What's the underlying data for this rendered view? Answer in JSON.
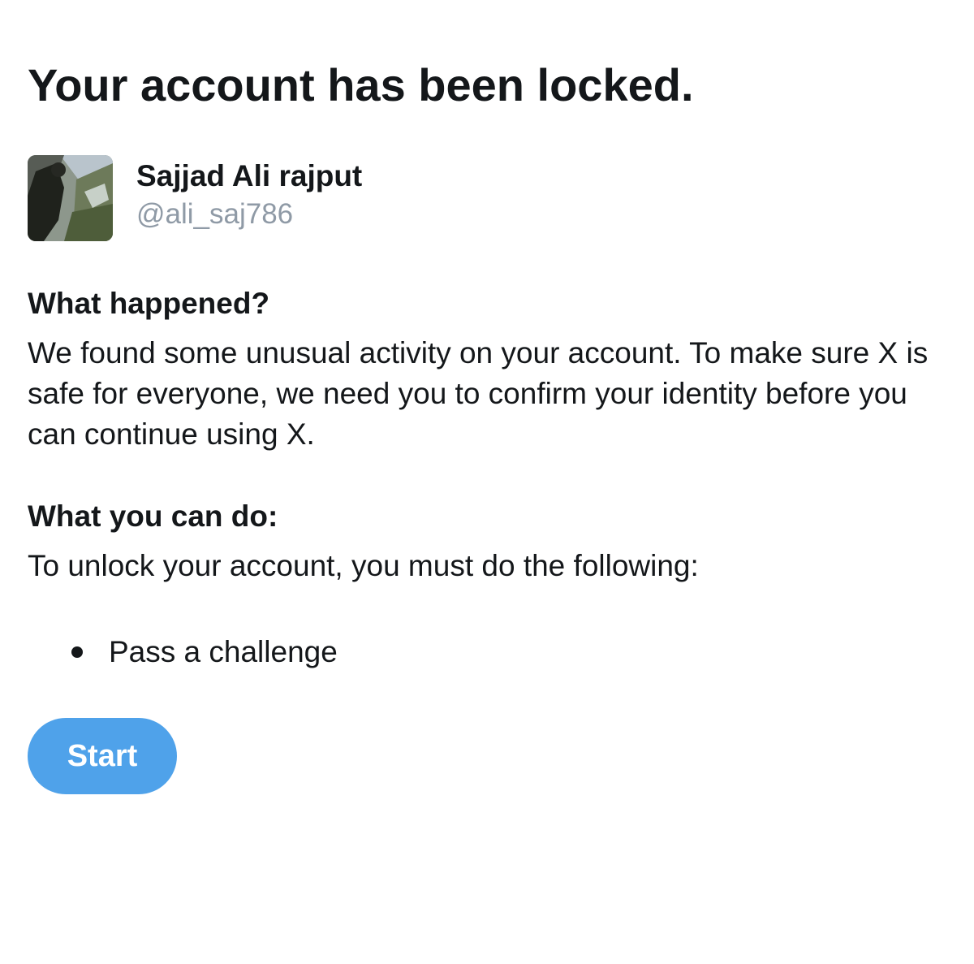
{
  "page": {
    "title": "Your account has been locked."
  },
  "account": {
    "display_name": "Sajjad Ali rajput",
    "handle": "@ali_saj786",
    "avatar_icon": "profile-photo"
  },
  "what_happened": {
    "heading": "What happened?",
    "body": "We found some unusual activity on your account. To make sure X is safe for everyone, we need you to confirm your identity before you can continue using X."
  },
  "what_you_can_do": {
    "heading": "What you can do:",
    "body": "To unlock your account, you must do the following:",
    "steps": [
      {
        "label": "Pass a challenge"
      }
    ]
  },
  "actions": {
    "start_label": "Start",
    "start_color": "#4fa2ea"
  },
  "colors": {
    "text": "#14171a",
    "muted": "#8f9aa6",
    "background": "#ffffff"
  }
}
